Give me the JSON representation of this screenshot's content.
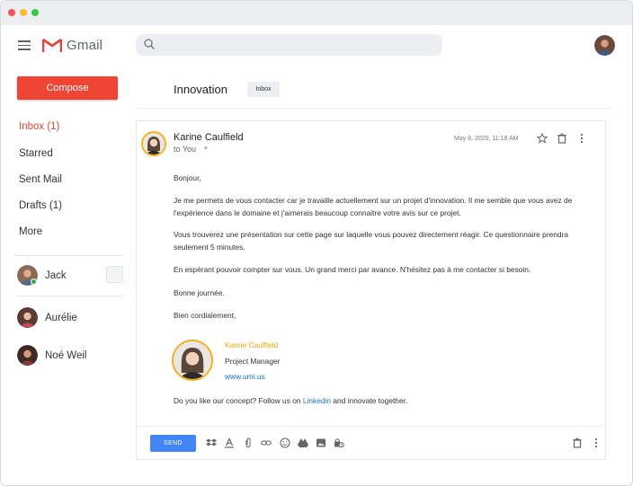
{
  "header": {
    "brand": "Gmail",
    "search_placeholder": ""
  },
  "sidebar": {
    "compose_label": "Compose",
    "items": [
      {
        "label": "Inbox (1)",
        "active": true
      },
      {
        "label": "Starred"
      },
      {
        "label": "Sent Mail"
      },
      {
        "label": "Drafts (1)"
      },
      {
        "label": "More"
      }
    ],
    "contacts": [
      {
        "name": "Jack",
        "online": true
      },
      {
        "name": "Aurélie"
      },
      {
        "name": "Noé Weil"
      }
    ]
  },
  "thread": {
    "subject": "Innovation",
    "label": "Inbox"
  },
  "message": {
    "sender": "Karine Caulfield",
    "to": "to You",
    "date": "May 8, 2020, 11:18 AM",
    "body": [
      "Bonjour,",
      "Je me permets de vous contacter car je travaille actuellement sur un projet d'innovation. Il me semble que vous avez de l'expérience dans le domaine et j'aimerais beaucoup connaitre votre avis sur ce projet.",
      "Vous trouverez une présentation sur cette page sur laquelle vous pouvez directement réagir. Ce questionnaire prendra seulement 5 minutes.",
      "En espérant pouvoir compter sur vous. Un grand merci par avance. N'hésitez pas à me contacter si besoin.",
      "Bonne journée.",
      "Bien cordialement,"
    ],
    "signature": {
      "name": "Karine Caulfield",
      "role": "Project Manager",
      "website": "www.umi.us"
    },
    "footer": {
      "before": "Do you like our concept? Follow us on ",
      "link": "Linkedin",
      "after": " and innovate together."
    }
  },
  "compose_bar": {
    "send_label": "SEND"
  },
  "colors": {
    "accent": "#ef4535",
    "gold": "#f6b21c",
    "link": "#1a73c9",
    "send": "#4285f4"
  }
}
